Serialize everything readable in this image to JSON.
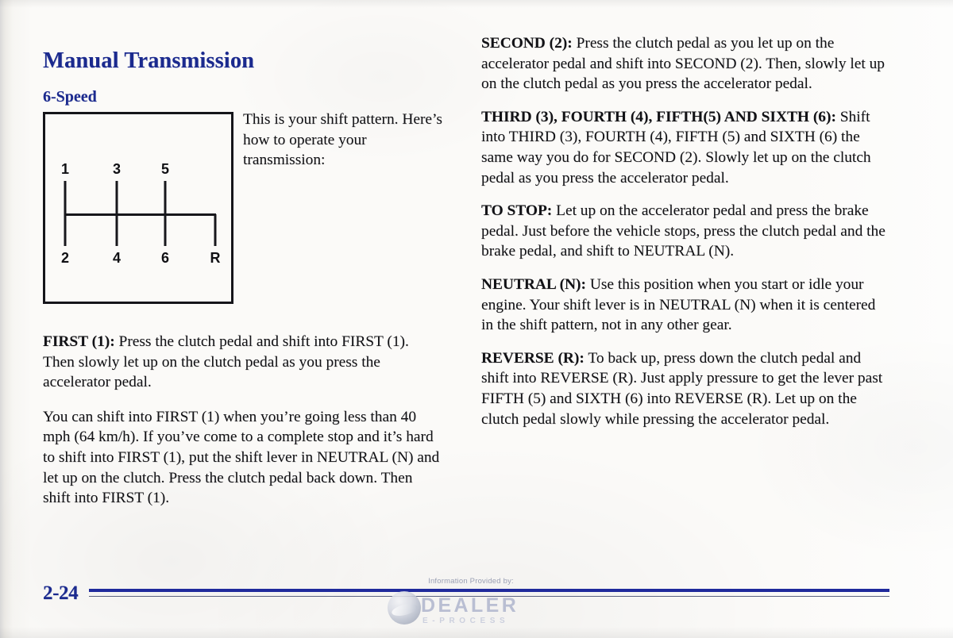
{
  "document": {
    "title": "Manual Transmission",
    "subtitle": "6-Speed",
    "page_number": "2-24"
  },
  "shift_diagram": {
    "caption": "This is your shift pattern. Here’s how to operate your transmission:",
    "top_labels": [
      "1",
      "3",
      "5"
    ],
    "bottom_labels": [
      "2",
      "4",
      "6",
      "R"
    ]
  },
  "left_column": {
    "paragraphs": [
      {
        "lead": "FIRST (1):",
        "body": " Press the clutch pedal and shift into FIRST (1). Then slowly let up on the clutch pedal as you press the accelerator pedal."
      },
      {
        "lead": "",
        "body": "You can shift into FIRST (1) when you’re going less than 40 mph (64 km/h). If you’ve come to a complete stop and it’s hard to shift into FIRST (1), put the shift lever in NEUTRAL (N) and let up on the clutch. Press the clutch pedal back down. Then shift into FIRST (1)."
      }
    ]
  },
  "right_column": {
    "paragraphs": [
      {
        "lead": "SECOND (2):",
        "body": " Press the clutch pedal as you let up on the accelerator pedal and shift into SECOND (2). Then, slowly let up on the clutch pedal as you press the accelerator pedal."
      },
      {
        "lead": "THIRD (3), FOURTH (4), FIFTH(5) AND SIXTH (6):",
        "body": " Shift into THIRD (3), FOURTH (4), FIFTH (5) and SIXTH (6) the same way you do for SECOND (2). Slowly let up on the clutch pedal as you press the accelerator pedal."
      },
      {
        "lead": "TO STOP:",
        "body": " Let up on the accelerator pedal and press the brake pedal. Just before the vehicle stops, press the clutch pedal and the brake pedal, and shift to NEUTRAL (N)."
      },
      {
        "lead": "NEUTRAL (N):",
        "body": " Use this position when you start or idle your engine. Your shift lever is in NEUTRAL (N) when it is centered in the shift pattern, not in any other gear."
      },
      {
        "lead": "REVERSE (R):",
        "body": " To back up, press down the clutch pedal and shift into REVERSE (R). Just apply pressure to get the lever past FIFTH (5) and SIXTH (6) into REVERSE (R). Let up on the clutch pedal slowly while pressing the accelerator pedal."
      }
    ]
  },
  "watermark": {
    "caption": "Information Provided by:",
    "brand": "DEALER",
    "brand_sub": "E-PROCESS"
  },
  "colors": {
    "heading_blue": "#1b2a8e",
    "rule_blue": "#1f2a9c",
    "body_black": "#121216",
    "watermark_gray": "#b9bed2"
  }
}
